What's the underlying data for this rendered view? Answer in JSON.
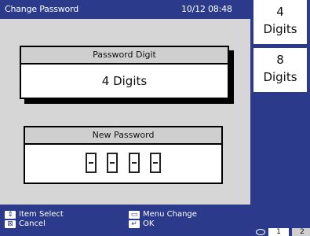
{
  "header": {
    "title": "Change Password",
    "datetime": "10/12 08:48"
  },
  "side_tabs": [
    {
      "line1": "4",
      "line2": "Digits",
      "selected": true
    },
    {
      "line1": "8",
      "line2": "Digits",
      "selected": false
    }
  ],
  "password_digit": {
    "label": "Password Digit",
    "value": "4 Digits"
  },
  "new_password": {
    "label": "New Password",
    "boxes": [
      "-",
      "-",
      "-",
      "-"
    ]
  },
  "hints": {
    "item_select": "Item Select",
    "cancel": "Cancel",
    "menu_change": "Menu Change",
    "ok": "OK"
  },
  "pager": {
    "page1": "1",
    "page2": "2"
  }
}
